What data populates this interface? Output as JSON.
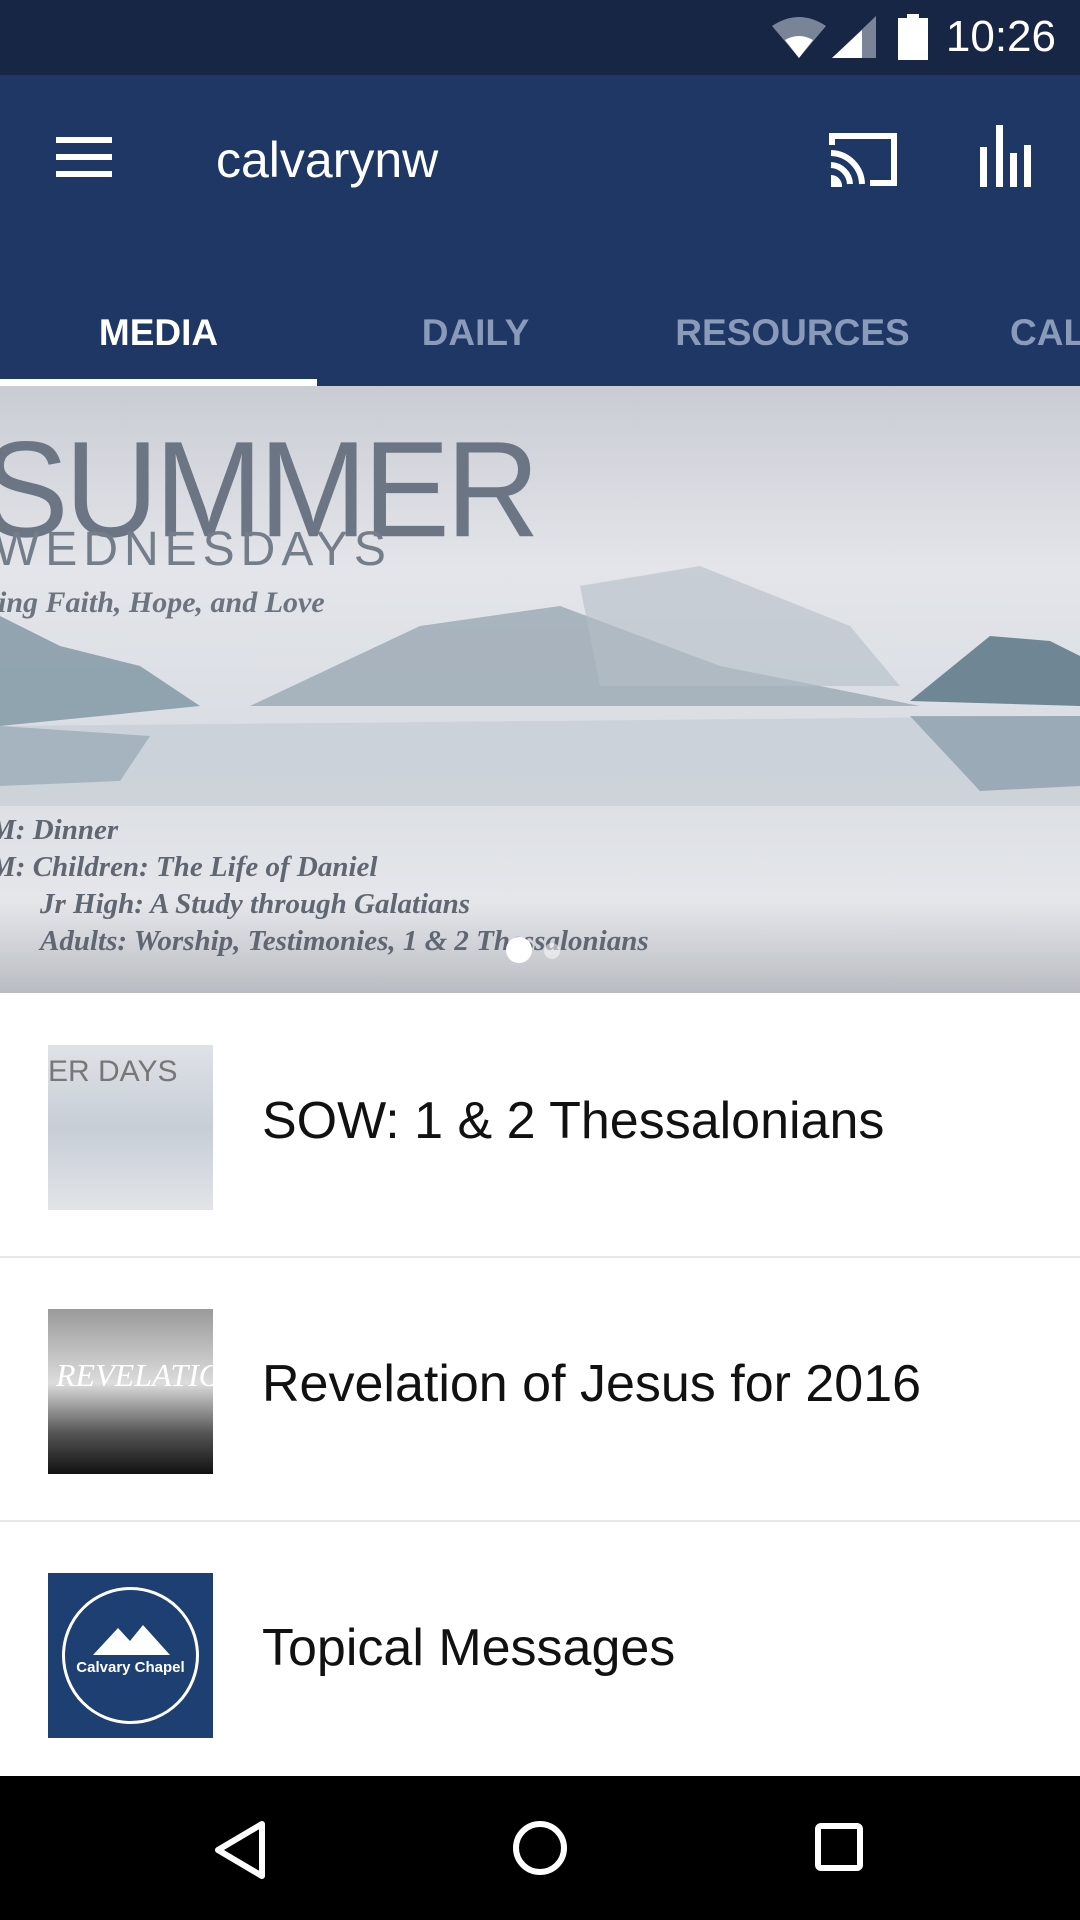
{
  "status_bar": {
    "time": "10:26",
    "icons": [
      "wifi-icon",
      "signal-icon",
      "battery-icon"
    ]
  },
  "toolbar": {
    "title": "calvarynw",
    "icons": [
      "menu-icon",
      "cast-icon",
      "equalizer-icon"
    ]
  },
  "tabs": [
    {
      "label": "MEDIA",
      "active": true
    },
    {
      "label": "DAILY"
    },
    {
      "label": "RESOURCES"
    },
    {
      "label": "CAL"
    }
  ],
  "banner": {
    "title": "SUMMER",
    "subtitle": "WEDNESDAYS",
    "tagline": "ing Faith, Hope, and Love",
    "lines": [
      "M: Dinner",
      "M: Children: The Life of Daniel",
      "Jr High: A Study through Galatians",
      "Adults: Worship, Testimonies, 1 & 2 Thessalonians"
    ],
    "page_count": 2,
    "current_page": 1
  },
  "list": [
    {
      "label": "SOW: 1 & 2 Thessalonians",
      "thumb_text": "ER DAYS"
    },
    {
      "label": "Revelation of Jesus for 2016",
      "thumb_text": "REVELATION"
    },
    {
      "label": "Topical Messages",
      "thumb_text": "Calvary Chapel"
    }
  ],
  "colors": {
    "appbar": "#1e3764",
    "status_bar": "#172645",
    "tab_inactive": "#8a9bba",
    "logo_bg": "#1d3f72"
  }
}
